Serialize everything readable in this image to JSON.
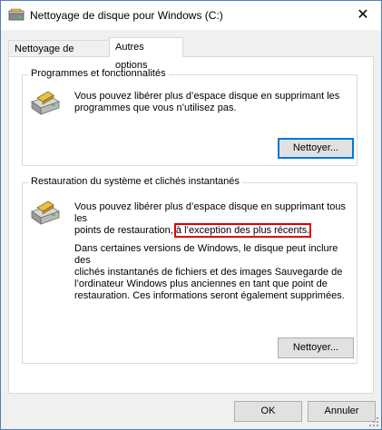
{
  "window": {
    "title": "Nettoyage de disque pour Windows (C:)",
    "close_glyph": "✕"
  },
  "tabs": [
    {
      "label": "Nettoyage de disque",
      "active": false
    },
    {
      "label": "Autres options",
      "active": true
    }
  ],
  "programs": {
    "title": "Programmes et fonctionnalités",
    "line1": "Vous pouvez libérer plus d’espace disque en supprimant les",
    "line2": "programmes que vous n’utilisez pas.",
    "button": "Nettoyer...",
    "icon": "hard-drive-programs-icon"
  },
  "restore": {
    "title": "Restauration du système et clichés instantanés",
    "line1": "Vous pouvez libérer plus d’espace disque en supprimant tous les",
    "line2_prefix": "points de restauration, ",
    "line2_highlight": "à l’exception des plus récents.",
    "info1": "Dans certaines versions de Windows, le disque peut inclure des",
    "info2": "clichés instantanés de fichiers et des images Sauvegarde de",
    "info3": "l’ordinateur Windows plus anciennes en tant que point de",
    "info4": "restauration. Ces informations seront également supprimées.",
    "button": "Nettoyer...",
    "icon": "hard-drive-restore-icon",
    "highlight_color": "#e00000"
  },
  "footer": {
    "ok": "OK",
    "cancel": "Annuler"
  },
  "colors": {
    "accent": "#0078d7",
    "window_border": "#4f7fbf"
  }
}
